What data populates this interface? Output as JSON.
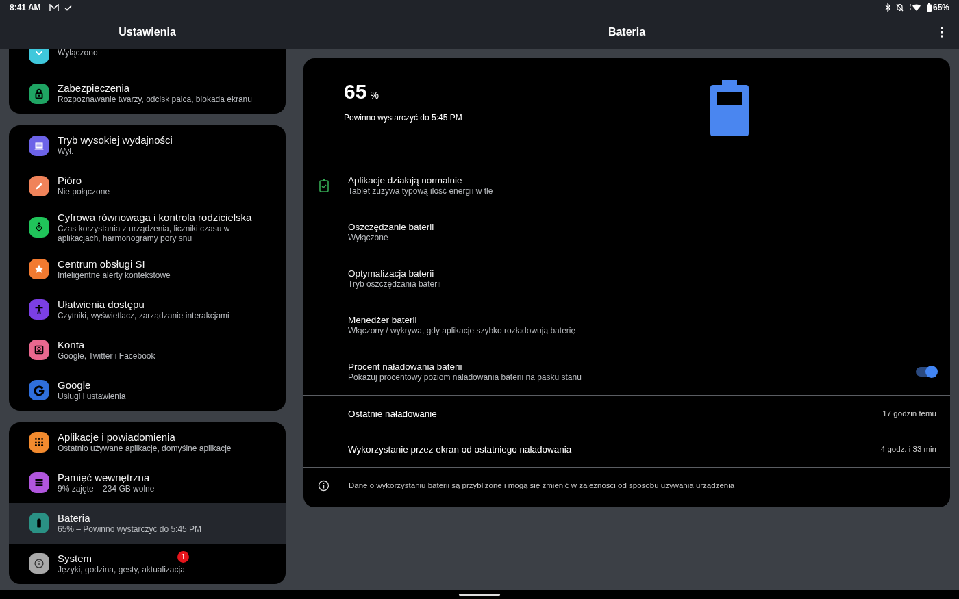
{
  "status_bar": {
    "time": "8:41 AM",
    "battery": "65%"
  },
  "sidebar": {
    "title": "Ustawienia",
    "groups": [
      {
        "items": [
          {
            "subtitle": "Wyłączono",
            "color": "#3fc8dc",
            "selected": false
          },
          {
            "title": "Zabezpieczenia",
            "subtitle": "Rozpoznawanie twarzy, odcisk palca, blokada ekranu",
            "color": "#1fa463",
            "selected": false
          }
        ]
      },
      {
        "items": [
          {
            "title": "Tryb wysokiej wydajności",
            "subtitle": "Wył.",
            "color": "#6c63e8",
            "selected": false
          },
          {
            "title": "Pióro",
            "subtitle": "Nie połączone",
            "color": "#f0835a",
            "selected": false
          },
          {
            "title": "Cyfrowa równowaga i kontrola rodzicielska",
            "subtitle": "Czas korzystania z urządzenia, liczniki czasu w aplikacjach, harmonogramy pory snu",
            "color": "#20c45a",
            "selected": false
          },
          {
            "title": "Centrum obsługi SI",
            "subtitle": "Inteligentne alerty kontekstowe",
            "color": "#f27a30",
            "selected": false
          },
          {
            "title": "Ułatwienia dostępu",
            "subtitle": "Czytniki, wyświetlacz, zarządzanie interakcjami",
            "color": "#7b3fe4",
            "selected": false
          },
          {
            "title": "Konta",
            "subtitle": "Google, Twitter i Facebook",
            "color": "#e9688f",
            "selected": false
          },
          {
            "title": "Google",
            "subtitle": "Usługi i ustawienia",
            "color": "#2f6fdc",
            "selected": false
          }
        ]
      },
      {
        "items": [
          {
            "title": "Aplikacje i powiadomienia",
            "subtitle": "Ostatnio używane aplikacje, domyślne aplikacje",
            "color": "#f28a2e",
            "selected": false
          },
          {
            "title": "Pamięć wewnętrzna",
            "subtitle": "9% zajęte – 234 GB wolne",
            "color": "#b156de",
            "selected": false
          },
          {
            "title": "Bateria",
            "subtitle": "65% – Powinno wystarczyć do 5:45 PM",
            "color": "#2a9184",
            "selected": true
          },
          {
            "title": "System",
            "subtitle": "Języki, godzina, gesty, aktualizacja",
            "color": "#a9a9a9",
            "selected": false,
            "badge": "1"
          }
        ]
      }
    ]
  },
  "page": {
    "title": "Bateria",
    "percent": "65",
    "percent_unit": "%",
    "estimate": "Powinno wystarczyć do 5:45 PM",
    "rows": [
      {
        "kind": "status",
        "title": "Aplikacje działają normalnie",
        "subtitle": "Tablet zużywa typową ilość energii w tle"
      },
      {
        "kind": "setting",
        "title": "Oszczędzanie baterii",
        "subtitle": "Wyłączone"
      },
      {
        "kind": "setting",
        "title": "Optymalizacja baterii",
        "subtitle": "Tryb oszczędzania baterii"
      },
      {
        "kind": "setting",
        "title": "Menedżer baterii",
        "subtitle": "Włączony / wykrywa, gdy aplikacje szybko rozładowują baterię"
      },
      {
        "kind": "toggle",
        "title": "Procent naładowania baterii",
        "subtitle": "Pokazuj procentowy poziom naładowania baterii na pasku stanu",
        "on": true
      }
    ],
    "stats": [
      {
        "label": "Ostatnie naładowanie",
        "value": "17 godzin temu"
      },
      {
        "label": "Wykorzystanie przez ekran od ostatniego naładowania",
        "value": "4 godz. i 33 min"
      }
    ],
    "note": "Dane o wykorzystaniu baterii są przybliżone i mogą się zmienić w zależności od sposobu używania urządzenia"
  }
}
